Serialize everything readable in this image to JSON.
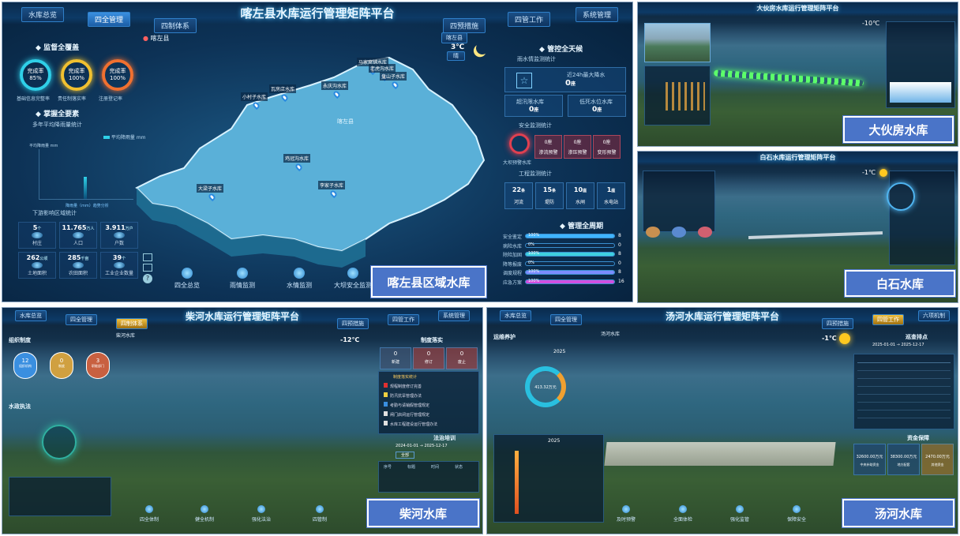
{
  "captions": {
    "kazuo": "喀左县区域水库",
    "dahuofang": "大伙房水库",
    "baishi": "白石水库",
    "chaihe": "柴河水库",
    "tanghe": "汤河水库"
  },
  "p1": {
    "title": "喀左县水库运行管理矩阵平台",
    "tabs": {
      "overview": "水库总览",
      "quanguan": "四全管理",
      "zhi": "四制体系",
      "cuo": "四预措施",
      "guan": "四管工作",
      "sys": "系统管理"
    },
    "location": "喀左县",
    "weather": {
      "badge": "喀左县",
      "temp": "3℃",
      "desc": "晴"
    },
    "sections": {
      "jianguan": "监督全覆盖",
      "zhangwo": "掌握全要素",
      "rain_stats": "多年平均降雨量统计",
      "downstream": "下游影响区域统计",
      "guankong": "管控全天候",
      "rain_monitor": "雨水情监测统计",
      "safety_monitor": "安全监测统计",
      "eng_monitor": "工程监测统计",
      "mgmt_cycle": "管理全周期"
    },
    "rings": [
      {
        "pct": "85%",
        "inner": "完成率",
        "label": "基础信息完整率",
        "color": "#2fd0e8"
      },
      {
        "pct": "100%",
        "inner": "完成率",
        "label": "责任制落实率",
        "color": "#f0c030"
      },
      {
        "pct": "100%",
        "inner": "完成率",
        "label": "注册登记率",
        "color": "#f07030"
      }
    ],
    "rain_legend": "平均降雨量 mm",
    "rain_axis": "平均降雨量 mm",
    "rain_note": "降雨量（mm）趋势分析",
    "stats": [
      {
        "value": "5",
        "unit": "个",
        "label": "村庄"
      },
      {
        "value": "11.765",
        "unit": "万人",
        "label": "人口"
      },
      {
        "value": "3.911",
        "unit": "万户",
        "label": "户数"
      },
      {
        "value": "262",
        "unit": "公顷",
        "label": "土地面积"
      },
      {
        "value": "285",
        "unit": "千亩",
        "label": "农田面积"
      },
      {
        "value": "39",
        "unit": "个",
        "label": "工业企业数量"
      }
    ],
    "map_center": "喀左县",
    "reservoirs": [
      "大梁子水库",
      "小村子水库",
      "瓦房店水库",
      "永庆沟水库",
      "鸡冠沟水库",
      "马家窝铺水库",
      "老虎沟水库",
      "李家子水库",
      "盘山子水库"
    ],
    "rain_summary": {
      "top_label": "近24h最大降水",
      "top_value": "0",
      "top_unit": "座",
      "left_label": "超汛限水库",
      "left_value": "0",
      "left_unit": "座",
      "right_label": "低死水位水库",
      "right_value": "0",
      "right_unit": "座"
    },
    "safety": {
      "circle_label": "大坝预警水库",
      "items": [
        {
          "count": "0座",
          "label": "渗流预警"
        },
        {
          "count": "0座",
          "label": "渗压预警"
        },
        {
          "count": "0座",
          "label": "变形预警"
        }
      ]
    },
    "eng": [
      {
        "value": "22",
        "unit": "条",
        "label": "河流"
      },
      {
        "value": "15",
        "unit": "条",
        "label": "堤防"
      },
      {
        "value": "10",
        "unit": "座",
        "label": "水闸"
      },
      {
        "value": "1",
        "unit": "座",
        "label": "水电站"
      }
    ],
    "cycle": [
      {
        "label": "安全鉴定",
        "pct": "100%",
        "fill": 1.0,
        "count": "8",
        "color": "#3fb4ff"
      },
      {
        "label": "病险水库",
        "pct": "0%",
        "fill": 0.0,
        "count": "0",
        "color": "#3fb4ff"
      },
      {
        "label": "除险加固",
        "pct": "100%",
        "fill": 1.0,
        "count": "8",
        "color": "#3fd0e0"
      },
      {
        "label": "降等报废",
        "pct": "0%",
        "fill": 0.0,
        "count": "0",
        "color": "#3fb4ff"
      },
      {
        "label": "调度规程",
        "pct": "100%",
        "fill": 1.0,
        "count": "8",
        "color": "#7a8cff"
      },
      {
        "label": "应急方案",
        "pct": "100%",
        "fill": 1.0,
        "count": "16",
        "color": "#d050e0"
      }
    ],
    "nav": [
      "四全总览",
      "雨情监测",
      "水情监测",
      "大坝安全监测"
    ]
  },
  "p2": {
    "title": "大伙房水库运行管理矩阵平台",
    "temp": "-10℃"
  },
  "p3": {
    "title": "白石水库运行管理矩阵平台",
    "temp": "-1℃"
  },
  "p4": {
    "title": "柴河水库运行管理矩阵平台",
    "tabs": {
      "overview": "水库总览",
      "quanguan": "四全管理",
      "zhi": "四制体系",
      "cuo": "四预措施",
      "guan": "四管工作",
      "sys": "系统管理"
    },
    "location": "柴河水库",
    "temp": "-12℃",
    "sections": {
      "left1": "组织制度",
      "left2": "水政执法",
      "right1": "制度落实",
      "right2": "法治培训"
    },
    "right_counts": [
      {
        "value": "0",
        "label": "新建"
      },
      {
        "value": "0",
        "label": "修订"
      },
      {
        "value": "0",
        "label": "废止"
      }
    ],
    "left_items": [
      {
        "value": "12",
        "label": "组织机构"
      },
      {
        "value": "0",
        "label": "制度"
      },
      {
        "value": "3",
        "label": "职能部门"
      }
    ],
    "list_title": "制度落实统计",
    "list": [
      "规程制度修订完善",
      "防汛抗旱管理办法",
      "考勤与请销假管理规定",
      "闸门启闭运行管理规定",
      "水库工程建设运行管理办法"
    ],
    "date_from": "2024-01-01",
    "date_to": "2025-12-17",
    "dropdown": "全部",
    "table_head": [
      "序号",
      "标题",
      "时间",
      "状态"
    ],
    "nav": [
      "四全体制",
      "健全机制",
      "强化法治",
      "四管制"
    ]
  },
  "p5": {
    "title": "汤河水库运行管理矩阵平台",
    "tabs": {
      "overview": "水库总览",
      "quanguan": "四全管理",
      "cuo": "四预措施",
      "guan": "四管工作",
      "sys": "六项机制"
    },
    "location": "汤河水库",
    "temp": "-1℃",
    "sections": {
      "left1": "运维养护",
      "right1": "巡查排点",
      "right2": "资金保障"
    },
    "year": "2025",
    "donut_value": "413.32万元",
    "date_from": "2025-01-01",
    "date_to": "2025-12-17",
    "funds": [
      {
        "value": "32600.00万元",
        "label": "中央补助资金"
      },
      {
        "value": "38300.00万元",
        "label": "地方配套"
      },
      {
        "value": "2470.00万元",
        "label": "其他资金"
      }
    ],
    "nav": [
      "及时预警",
      "全面体检",
      "强化监管",
      "保障安全"
    ]
  }
}
